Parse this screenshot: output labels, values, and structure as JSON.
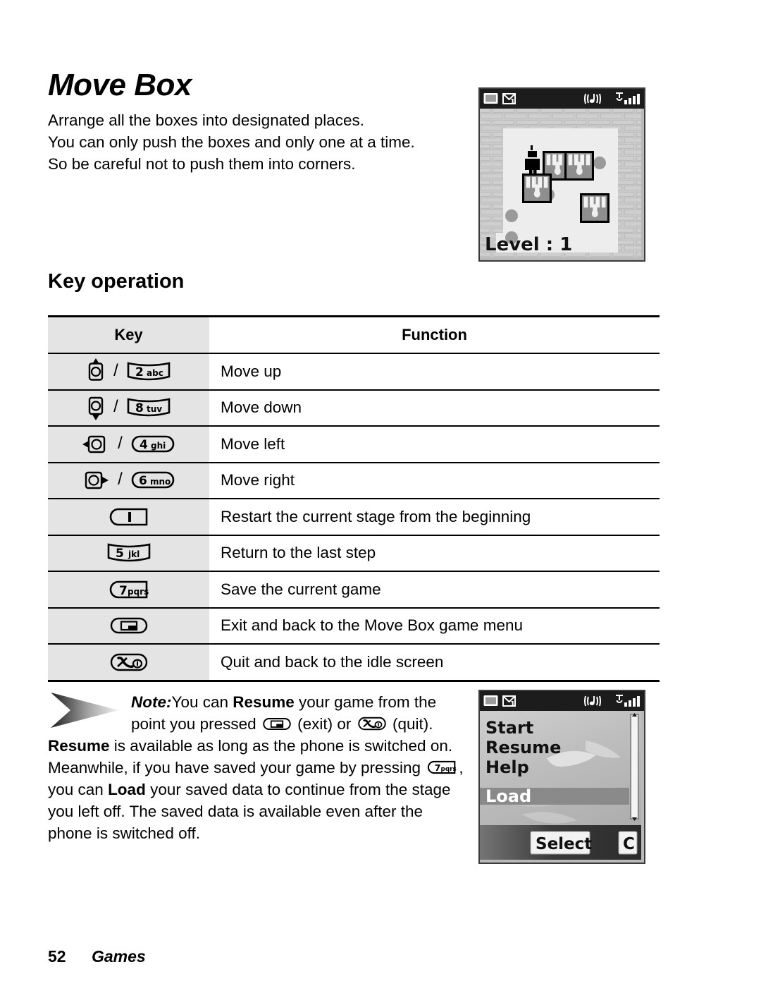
{
  "page": {
    "title": "Move Box",
    "intro_lines": [
      "Arrange all the boxes into designated places.",
      "You can only push the boxes and only one at a time.",
      "So be careful not to push them into corners."
    ],
    "section_heading": "Key operation"
  },
  "key_table": {
    "headers": {
      "key": "Key",
      "function": "Function"
    },
    "rows": [
      {
        "keys": [
          "nav-up-key",
          "2abc-key"
        ],
        "key_labels": [
          "",
          "2",
          "abc"
        ],
        "function": "Move up"
      },
      {
        "keys": [
          "nav-down-key",
          "8tuv-key"
        ],
        "key_labels": [
          "",
          "8",
          "tuv"
        ],
        "function": "Move down"
      },
      {
        "keys": [
          "nav-left-key",
          "4ghi-key"
        ],
        "key_labels": [
          "",
          "4",
          "ghi"
        ],
        "function": "Move left"
      },
      {
        "keys": [
          "nav-right-key",
          "6mno-key"
        ],
        "key_labels": [
          "",
          "6",
          "mno"
        ],
        "function": "Move right"
      },
      {
        "keys": [
          "1-key"
        ],
        "key_labels": [
          "1",
          ""
        ],
        "function": "Restart the current stage from the beginning"
      },
      {
        "keys": [
          "5jkl-key"
        ],
        "key_labels": [
          "5",
          "jkl"
        ],
        "function": "Return to the last step"
      },
      {
        "keys": [
          "7pqrs-key"
        ],
        "key_labels": [
          "7",
          "pqrs"
        ],
        "function": "Save the current game"
      },
      {
        "keys": [
          "back-exit-key"
        ],
        "key_labels": [
          "",
          ""
        ],
        "function": "Exit and back to the Move Box game menu"
      },
      {
        "keys": [
          "end-quit-key"
        ],
        "key_labels": [
          "",
          ""
        ],
        "function": "Quit and back to the idle screen"
      }
    ],
    "separator": "/"
  },
  "note": {
    "label": "Note:",
    "line1_a": "You can ",
    "line1_b": "Resume",
    "line1_c": " your game from the",
    "line2_a": "point you pressed",
    "line2_b": "(exit) or",
    "line2_c": "(quit).",
    "line3_a": "Resume",
    "line3_b": " is available as long as the phone is switched on.",
    "line4_a": "Meanwhile, if you have saved your game by pressing",
    "line4_b": ",",
    "line5_a": "you can ",
    "line5_b": "Load",
    "line5_c": " your saved data to continue from the stage",
    "line6": "you left off. The saved data is available even after the",
    "line7": "phone is switched off."
  },
  "game_screen": {
    "status_icons": [
      "battery-icon",
      "message-icon",
      "music-icon",
      "signal-icon"
    ],
    "message_count": "1",
    "level_text": "Level : 1",
    "boxes_placed": 2,
    "boxes_total": 4,
    "targets": 4
  },
  "menu_screen": {
    "status_icons": [
      "battery-icon",
      "message-icon",
      "music-icon",
      "signal-icon"
    ],
    "message_count": "1",
    "items": [
      {
        "label": "Start",
        "selected": false
      },
      {
        "label": "Resume",
        "selected": false
      },
      {
        "label": "Help",
        "selected": false
      },
      {
        "label": "Load",
        "selected": true
      }
    ],
    "softkey_left": "Select",
    "softkey_right": "C"
  },
  "footer": {
    "page_number": "52",
    "chapter": "Games"
  },
  "colors": {
    "key_column_bg": "#e4e4e4",
    "rule": "#000000",
    "phone_status_bar": "#1c1c1c",
    "menu_highlight": "#8a8a8a",
    "paper": "#ffffff"
  }
}
